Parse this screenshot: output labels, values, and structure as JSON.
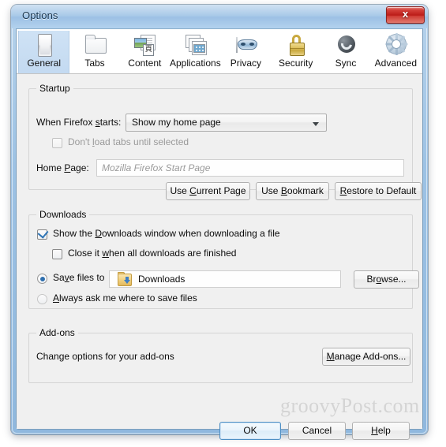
{
  "window": {
    "title": "Options",
    "close_label": "x"
  },
  "tabs": [
    {
      "label": "General",
      "icon": "browser-window-icon",
      "selected": true
    },
    {
      "label": "Tabs",
      "icon": "folder-tabs-icon",
      "selected": false
    },
    {
      "label": "Content",
      "icon": "content-page-icon",
      "selected": false
    },
    {
      "label": "Applications",
      "icon": "applications-icon",
      "selected": false
    },
    {
      "label": "Privacy",
      "icon": "privacy-mask-icon",
      "selected": false
    },
    {
      "label": "Security",
      "icon": "security-lock-icon",
      "selected": false
    },
    {
      "label": "Sync",
      "icon": "sync-refresh-icon",
      "selected": false
    },
    {
      "label": "Advanced",
      "icon": "advanced-gear-icon",
      "selected": false
    }
  ],
  "startup": {
    "group_title": "Startup",
    "when_firefox_starts_label_pre": "When Firefox ",
    "when_firefox_starts_accel": "s",
    "when_firefox_starts_label_post": "tarts:",
    "startup_select_value": "Show my home page",
    "dont_load_tabs_pre": "Don't ",
    "dont_load_tabs_accel": "l",
    "dont_load_tabs_post": "oad tabs until selected",
    "dont_load_tabs_checked": false,
    "dont_load_tabs_disabled": true,
    "home_page_label_pre": "Home ",
    "home_page_accel": "P",
    "home_page_label_post": "age:",
    "home_page_placeholder": "Mozilla Firefox Start Page",
    "home_page_value": "",
    "use_current_page_pre": "Use ",
    "use_current_page_accel": "C",
    "use_current_page_post": "urrent Page",
    "use_bookmark_pre": "Use ",
    "use_bookmark_accel": "B",
    "use_bookmark_post": "ookmark",
    "restore_default_pre": "",
    "restore_default_accel": "R",
    "restore_default_post": "estore to Default"
  },
  "downloads": {
    "group_title": "Downloads",
    "show_window_pre": "Show the ",
    "show_window_accel": "D",
    "show_window_post": "ownloads window when downloading a file",
    "show_window_checked": true,
    "close_when_done_pre": "Close it ",
    "close_when_done_accel": "w",
    "close_when_done_post": "hen all downloads are finished",
    "close_when_done_checked": false,
    "save_files_to_pre": "Sa",
    "save_files_to_accel": "v",
    "save_files_to_post": "e files to",
    "save_files_to_selected": true,
    "save_path_value": "Downloads",
    "save_path_icon": "downloads-folder-icon",
    "browse_pre": "Br",
    "browse_accel": "o",
    "browse_post": "wse...",
    "always_ask_pre": "",
    "always_ask_accel": "A",
    "always_ask_post": "lways ask me where to save files",
    "always_ask_selected": false
  },
  "addons": {
    "group_title": "Add-ons",
    "description": "Change options for your add-ons",
    "manage_pre": "",
    "manage_accel": "M",
    "manage_post": "anage Add-ons..."
  },
  "footer": {
    "ok_label": "OK",
    "cancel_label": "Cancel",
    "help_pre": "",
    "help_accel": "H",
    "help_post": "elp"
  },
  "watermark": {
    "text": "groovyPost.com"
  }
}
